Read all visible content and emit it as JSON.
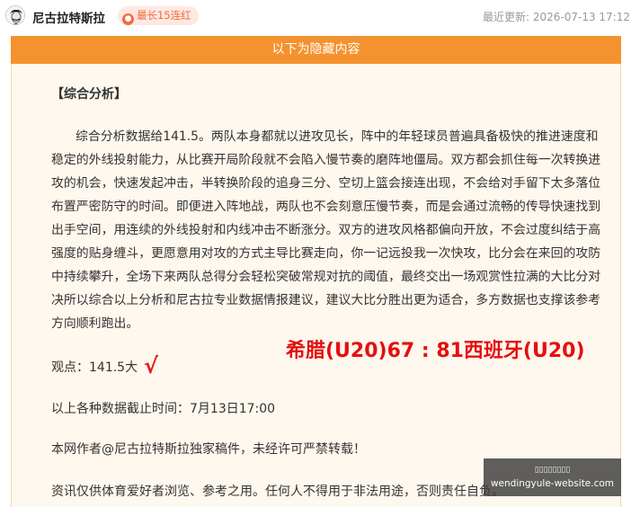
{
  "header": {
    "author_name": "尼古拉特斯拉",
    "streak_badge": "最长15连红",
    "last_updated_label": "最近更新: 2026-07-13 17:12"
  },
  "hidden_banner": "以下为隐藏内容",
  "article": {
    "section_heading": "【综合分析】",
    "analysis_paragraph": "综合分析数据给141.5。两队本身都就以进攻见长，阵中的年轻球员普遍具备极快的推进速度和稳定的外线投射能力，从比赛开局阶段就不会陷入慢节奏的磨阵地僵局。双方都会抓住每一次转换进攻的机会，快速发起冲击，半转换阶段的追身三分、空切上篮会接连出现，不会给对手留下太多落位布置严密防守的时间。即便进入阵地战，两队也不会刻意压慢节奏，而是会通过流畅的传导快速找到出手空间，用连续的外线投射和内线冲击不断涨分。双方的进攻风格都偏向开放，不会过度纠结于高强度的贴身缠斗，更愿意用对攻的方式主导比赛走向，你一记远投我一次快攻，比分会在来回的攻防中持续攀升，全场下来两队总得分会轻松突破常规对抗的阈值，最终交出一场观赏性拉满的大比分对决所以综合以上分析和尼古拉专业数据情报建议，建议大比分胜出更为适合，多方数据也支撑该参考方向顺利跑出。",
    "viewpoint": "观点：141.5大",
    "result_mark": "√",
    "match_result": "希腊(U20)67 : 81西班牙(U20)",
    "deadline": "以上各种数据截止时间：7月13日17:00",
    "copyright": "本网作者@尼古拉特斯拉独家稿件，未经许可严禁转载！",
    "disclaimer": "资讯仅供体育爱好者浏览、参考之用。任何人不得用于非法用途，否则责任自负。"
  },
  "watermark": {
    "line1": "▯▯▯▯▯▯▯▯",
    "line2": "wendingyule-website.com"
  },
  "colors": {
    "banner": "#f4922f",
    "panel_bg": "#fff8ee",
    "result_red": "#e50f0f",
    "badge_text": "#f26a3a"
  }
}
